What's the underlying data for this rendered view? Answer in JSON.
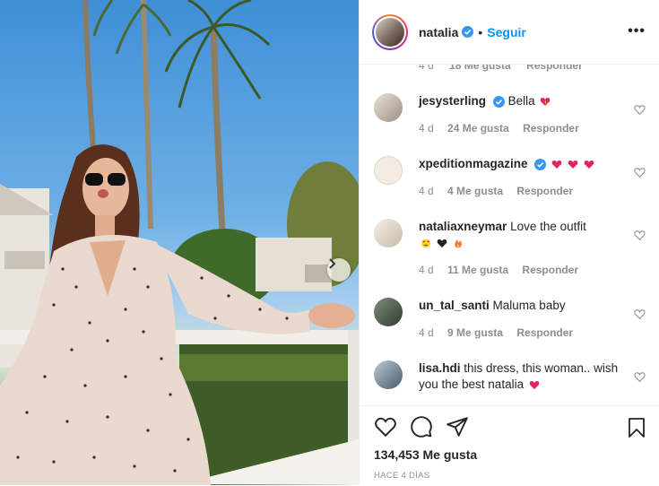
{
  "header": {
    "username": "natalia",
    "separator": "•",
    "follow_label": "Seguir",
    "more_label": "•••"
  },
  "clipped_comment": {
    "time": "4 d",
    "likes": "18 Me gusta",
    "reply": "Responder"
  },
  "comments": [
    {
      "user": "jesysterling",
      "verified": true,
      "text": "Bella",
      "emoji": [
        "heart-sparkle"
      ],
      "time": "4 d",
      "likes": "24 Me gusta",
      "reply": "Responder"
    },
    {
      "user": "xpeditionmagazine",
      "verified": true,
      "text": "",
      "emoji": [
        "red-heart",
        "red-heart",
        "red-heart"
      ],
      "time": "4 d",
      "likes": "4 Me gusta",
      "reply": "Responder"
    },
    {
      "user": "nataliaxneymar",
      "verified": false,
      "text": "Love the outfit",
      "emoji": [
        "heart-eyes",
        "black-heart",
        "fire"
      ],
      "time": "4 d",
      "likes": "11 Me gusta",
      "reply": "Responder"
    },
    {
      "user": "un_tal_santi",
      "verified": false,
      "text": "Maluma baby",
      "emoji": [],
      "time": "4 d",
      "likes": "9 Me gusta",
      "reply": "Responder"
    },
    {
      "user": "lisa.hdi",
      "verified": false,
      "text": "this dress, this woman.. wish you the best natalia",
      "emoji": [
        "red-heart"
      ],
      "time": "",
      "likes": "",
      "reply": ""
    }
  ],
  "footer": {
    "likes": "134,453 Me gusta",
    "ago": "HACE 4 DÍAS"
  },
  "icons": {
    "like": "heart-outline-icon",
    "comment": "comment-bubble-icon",
    "share": "paper-plane-icon",
    "save": "bookmark-icon",
    "next": "chevron-right-icon"
  },
  "colors": {
    "accent": "#0095f6",
    "verified": "#3897f0",
    "heart": "#ed4956"
  }
}
